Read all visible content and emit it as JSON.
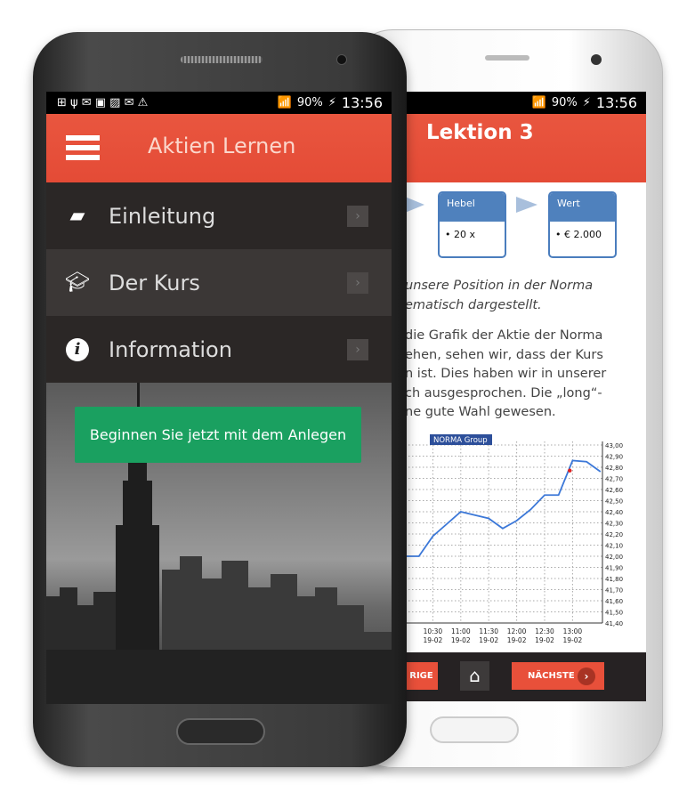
{
  "left_phone": {
    "status_time": "13:56",
    "status_battery": "90%",
    "app_title": "Aktien Lernen",
    "menu": [
      {
        "label": "Einleitung",
        "icon": "speech-bubble-icon"
      },
      {
        "label": "Der Kurs",
        "icon": "graduation-cap-icon"
      },
      {
        "label": "Information",
        "icon": "info-icon"
      }
    ],
    "cta_button": "Beginnen Sie jetzt mit dem Anlegen"
  },
  "right_phone": {
    "status_time": "13:56",
    "status_battery": "90%",
    "title": "Lektion 3",
    "boxes": [
      {
        "title": "Hebel",
        "value": "• 20 x"
      },
      {
        "title": "Wert",
        "value": "• € 2.000"
      }
    ],
    "italic_lines": [
      "unsere Position in der Norma",
      "ematisch dargestellt."
    ],
    "body_lines": [
      "die Grafik der Aktie der Norma",
      "ehen, sehen wir, dass der Kurs",
      "n ist. Dies haben wir in unserer",
      "ch ausgesprochen. Die „long“-",
      "ne gute Wahl gewesen."
    ],
    "prev_button": "RIGE",
    "next_button": "NÄCHSTE"
  },
  "colors": {
    "accent": "#e8503a",
    "green": "#1aa060",
    "chart_line": "#3c78d8",
    "box_blue": "#4f81bd"
  },
  "chart_data": {
    "type": "line",
    "title": "NORMA Group",
    "x": [
      "10:00",
      "10:15",
      "10:30",
      "10:45",
      "11:00",
      "11:15",
      "11:30",
      "11:45",
      "12:00",
      "12:15",
      "12:30",
      "12:45",
      "13:00",
      "13:15",
      "13:30"
    ],
    "values": [
      42.0,
      42.0,
      42.18,
      42.29,
      42.4,
      42.37,
      42.34,
      42.25,
      42.32,
      42.42,
      42.55,
      42.55,
      42.86,
      42.85,
      42.76
    ],
    "marker": {
      "x": "12:57",
      "y": 42.77
    },
    "xticks": [
      {
        "time": "10:30",
        "date": "19-02"
      },
      {
        "time": "11:00",
        "date": "19-02"
      },
      {
        "time": "11:30",
        "date": "19-02"
      },
      {
        "time": "12:00",
        "date": "19-02"
      },
      {
        "time": "12:30",
        "date": "19-02"
      },
      {
        "time": "13:00",
        "date": "19-02"
      }
    ],
    "yticks": [
      "43,00",
      "42,90",
      "42,80",
      "42,70",
      "42,60",
      "42,50",
      "42,40",
      "42,30",
      "42,20",
      "42,10",
      "42,00",
      "41,90",
      "41,80",
      "41,70",
      "41,60",
      "41,50",
      "41,40"
    ],
    "ylim": [
      41.4,
      43.0
    ],
    "grid": true
  }
}
